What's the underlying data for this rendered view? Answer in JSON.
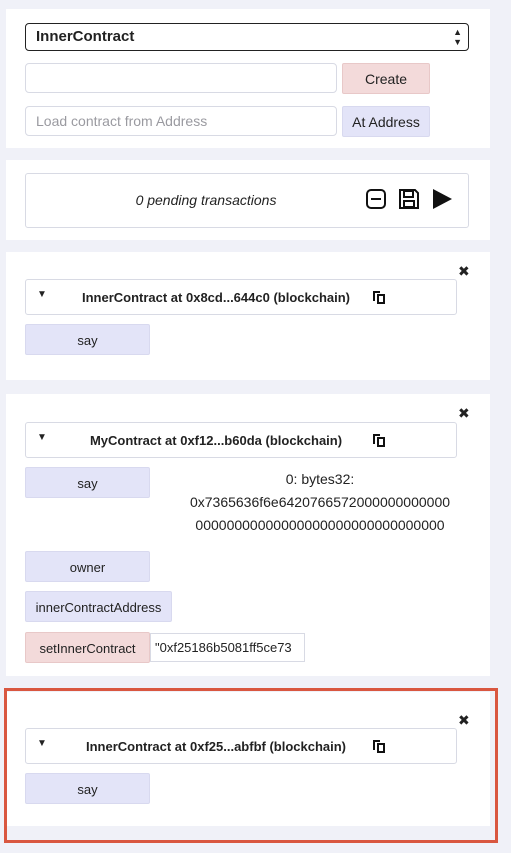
{
  "deploy": {
    "contract_select": "InnerContract",
    "constructor_input_value": "",
    "create_label": "Create",
    "address_placeholder": "Load contract from Address",
    "at_address_label": "At Address"
  },
  "pending": {
    "text": "0 pending transactions"
  },
  "instances": [
    {
      "title": "InnerContract at 0x8cd...644c0 (blockchain)",
      "functions": [
        {
          "label": "say",
          "kind": "call"
        }
      ]
    },
    {
      "title": "MyContract at 0xf12...b60da (blockchain)",
      "functions": [
        {
          "label": "say",
          "kind": "call"
        },
        {
          "label": "owner",
          "kind": "call"
        },
        {
          "label": "innerContractAddress",
          "kind": "call"
        },
        {
          "label": "setInnerContract",
          "kind": "transact",
          "arg_value": "\"0xf25186b5081ff5ce73"
        }
      ],
      "result_lines": [
        "0: bytes32:",
        "0x7365636f6e6420766572000000000000",
        "00000000000000000000000000000000"
      ]
    },
    {
      "title": "InnerContract at 0xf25...abfbf (blockchain)",
      "functions": [
        {
          "label": "say",
          "kind": "call"
        }
      ]
    }
  ],
  "colors": {
    "call_button": "#e3e4f8",
    "transact_button": "#f3dada",
    "highlight_border": "#d95740",
    "background": "#f0f1f8"
  }
}
